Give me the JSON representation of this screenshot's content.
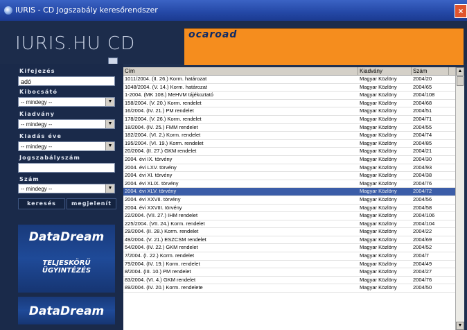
{
  "window": {
    "title": "IURIS - CD Jogszabály keresőrendszer",
    "close_glyph": "×"
  },
  "header": {
    "logo_text": "IURIS.HU CD",
    "banner_brand": "ocaroad"
  },
  "sidebar": {
    "kifejezes_label": "Kifejezés",
    "kifejezes_value": "adó",
    "kibocsato_label": "Kibocsátó",
    "kibocsato_value": "-- mindegy --",
    "kiadvany_label": "Kiadvány",
    "kiadvany_value": "-- mindegy --",
    "kiadas_eve_label": "Kiadás éve",
    "kiadas_eve_value": "-- mindegy --",
    "jogszabalyszam_label": "Jogszabályszám",
    "jogszabalyszam_value": "",
    "szam_label": "Szám",
    "szam_value": "-- mindegy --",
    "search_button": "keresés",
    "show_button": "megjelenít",
    "ad1_name": "DataDream",
    "ad_slogan_1": "TELJESKÖRŰ",
    "ad_slogan_2": "ÜGYINTÉZÉS",
    "ad2_name": "DataDream"
  },
  "table": {
    "headers": [
      "Cím",
      "Kiadvány",
      "Szám"
    ],
    "selected_index": 14,
    "rows": [
      [
        "1011/2004. (II. 26.) Korm. határozat",
        "Magyar Közlöny",
        "2004/20"
      ],
      [
        "1048/2004. (V. 14.) Korm. határozat",
        "Magyar Közlöny",
        "2004/65"
      ],
      [
        "1-2004. (MK 108.) MeHVM tájékoztató",
        "Magyar Közlöny",
        "2004/108"
      ],
      [
        "158/2004. (V. 20.) Korm. rendelet",
        "Magyar Közlöny",
        "2004/68"
      ],
      [
        "16/2004. (IV. 21.) PM rendelet",
        "Magyar Közlöny",
        "2004/51"
      ],
      [
        "178/2004. (V. 26.) Korm. rendelet",
        "Magyar Közlöny",
        "2004/71"
      ],
      [
        "18/2004. (IV. 25.) FMM rendelet",
        "Magyar Közlöny",
        "2004/55"
      ],
      [
        "182/2004. (VI. 2.) Korm. rendelet",
        "Magyar Közlöny",
        "2004/74"
      ],
      [
        "195/2004. (VI. 19.) Korm. rendelet",
        "Magyar Közlöny",
        "2004/85"
      ],
      [
        "20/2004. (II. 27.) GKM rendelet",
        "Magyar Közlöny",
        "2004/21"
      ],
      [
        "2004. évi IX. törvény",
        "Magyar Közlöny",
        "2004/30"
      ],
      [
        "2004. évi LXV. törvény",
        "Magyar Közlöny",
        "2004/93"
      ],
      [
        "2004. évi XI. törvény",
        "Magyar Közlöny",
        "2004/38"
      ],
      [
        "2004. évi XLIX. törvény",
        "Magyar Közlöny",
        "2004/76"
      ],
      [
        "2004. évi XLV. törvény",
        "Magyar Közlöny",
        "2004/72"
      ],
      [
        "2004. évi XXVII. törvény",
        "Magyar Közlöny",
        "2004/56"
      ],
      [
        "2004. évi XXVIII. törvény",
        "Magyar Közlöny",
        "2004/58"
      ],
      [
        "22/2004. (VII. 27.) IHM rendelet",
        "Magyar Közlöny",
        "2004/106"
      ],
      [
        "225/2004. (VII. 24.) Korm. rendelet",
        "Magyar Közlöny",
        "2004/104"
      ],
      [
        "29/2004. (II. 28.) Korm. rendelet",
        "Magyar Közlöny",
        "2004/22"
      ],
      [
        "49/2004. (V. 21.) ESZCSM rendelet",
        "Magyar Közlöny",
        "2004/69"
      ],
      [
        "54/2004. (IV. 22.) GKM rendelet",
        "Magyar Közlöny",
        "2004/52"
      ],
      [
        "7/2004. (I. 22.) Korm. rendelet",
        "Magyar Közlöny",
        "2004/7"
      ],
      [
        "79/2004. (IV. 19.) Korm. rendelet",
        "Magyar Közlöny",
        "2004/49"
      ],
      [
        "8/2004. (III. 10.) PM rendelet",
        "Magyar Közlöny",
        "2004/27"
      ],
      [
        "83/2004. (VI. 4.) GKM rendelet",
        "Magyar Közlöny",
        "2004/76"
      ],
      [
        "89/2004. (IV. 20.) Korm. rendelete",
        "Magyar Közlöny",
        "2004/50"
      ]
    ]
  },
  "colors": {
    "selected_row": "#3b5da8",
    "banner": "#f58d1e",
    "panel": "#1a2a4a"
  }
}
